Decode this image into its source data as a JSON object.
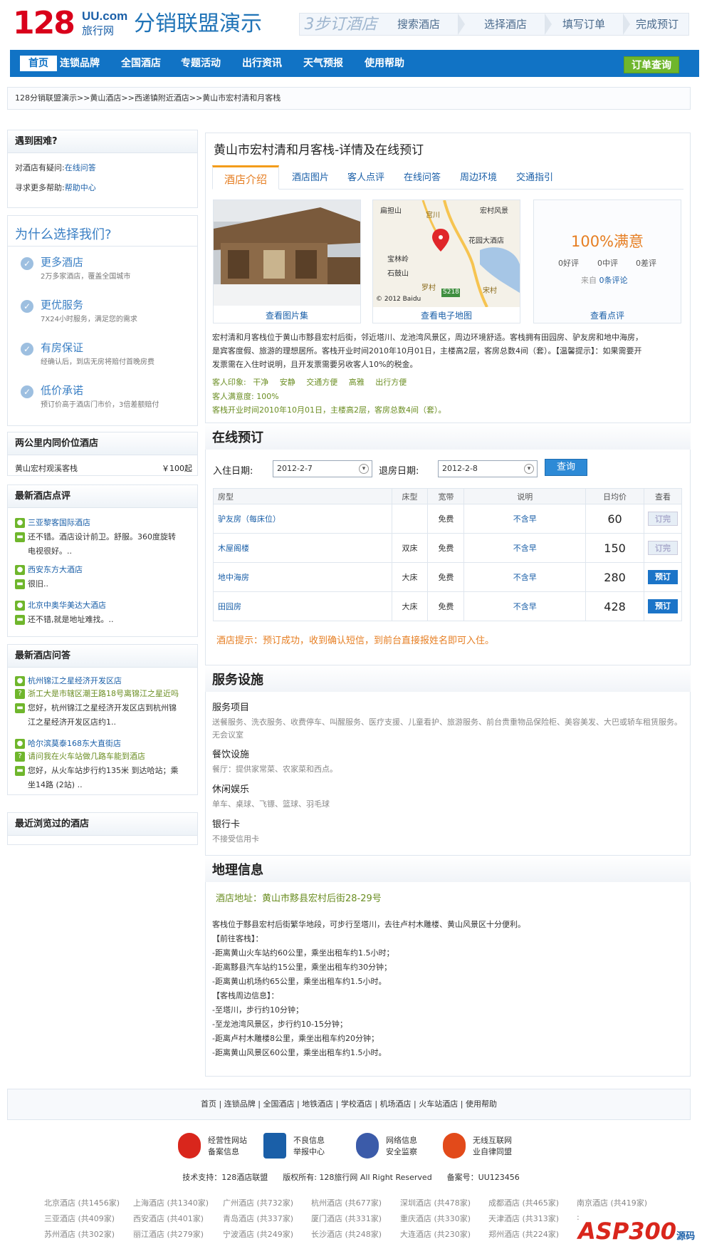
{
  "header": {
    "logo_num": "128",
    "logo_uu": "UU.com",
    "logo_text": "旅行网",
    "brand": "分销联盟演示",
    "steps_title": "3步订酒店",
    "steps": [
      "搜索酒店",
      "选择酒店",
      "填写订单",
      "完成预订"
    ]
  },
  "nav": {
    "items": [
      "首页",
      "连锁品牌",
      "全国酒店",
      "专题活动",
      "出行资讯",
      "天气预报",
      "使用帮助"
    ],
    "order_query": "订单查询"
  },
  "breadcrumb": "128分销联盟演示>>黄山酒店>>西递镇附近酒店>>黄山市宏村清和月客栈",
  "sidebar": {
    "help": {
      "title": "遇到困难?",
      "q1_label": "对酒店有疑问:",
      "q1_link": "在线问答",
      "q2_label": "寻求更多帮助:",
      "q2_link": "帮助中心"
    },
    "why": {
      "title": "为什么选择我们?",
      "items": [
        {
          "t": "更多酒店",
          "d": "2万多家酒店，覆盖全国城市"
        },
        {
          "t": "更优服务",
          "d": "7X24小时服务，满足您的需求"
        },
        {
          "t": "有房保证",
          "d": "经确认后，到店无房将赔付首晚房费"
        },
        {
          "t": "低价承诺",
          "d": "预订价高于酒店门市价，3倍差额赔付"
        }
      ]
    },
    "nearby": {
      "title": "两公里内同价位酒店",
      "hotel": "黄山宏村观溪客栈",
      "price": "￥100起"
    },
    "reviews": {
      "title": "最新酒店点评",
      "items": [
        {
          "hotel": "三亚黎客国际酒店",
          "text1": "还不错。酒店设计前卫。舒服。360度旋转",
          "text2": "电视很好。.."
        },
        {
          "hotel": "西安东方大酒店",
          "text1": "很旧.."
        },
        {
          "hotel": "北京中奥华美达大酒店",
          "text1": "还不错,就是地址难找。.."
        }
      ]
    },
    "qa": {
      "title": "最新酒店问答",
      "items": [
        {
          "hotel": "杭州锦江之星经济开发区店",
          "q": "浙工大是市辖区潮王路18号离锦江之星近吗",
          "a1": "您好，杭州锦江之星经济开发区店到杭州锦",
          "a2": "江之星经济开发区店约1.."
        },
        {
          "hotel": "哈尔滨莫泰168东大直街店",
          "q": "请问我在火车站做几路车能到酒店",
          "a1": "您好，从火车站步行约135米 到达哈站；乘",
          "a2": "坐14路 (2站) .."
        }
      ]
    },
    "recent": {
      "title": "最近浏览过的酒店"
    }
  },
  "main": {
    "title": "黄山市宏村清和月客栈-详情及在线预订",
    "tabs": [
      "酒店介绍",
      "酒店图片",
      "客人点评",
      "在线问答",
      "周边环境",
      "交通指引"
    ],
    "photo_caption": "查看图片集",
    "map": {
      "labels": [
        "扁担山",
        "宫川",
        "宏村风景",
        "花园大酒店",
        "宝林岭",
        "石鼓山",
        "罗村",
        "宋村",
        "S218"
      ],
      "copyright": "© 2012 Baidu",
      "caption": "查看电子地图"
    },
    "rating": {
      "score": "100%满意",
      "good": "0好评",
      "mid": "0中评",
      "bad": "0差评",
      "from_label": "来自",
      "from_link": "0条评论",
      "caption": "查看点评"
    },
    "desc": [
      "宏村清和月客栈位于黄山市黟县宏村后街，邻近塔川、龙池湾风景区，周边环境舒适。客栈拥有田园房、驴友房和地中海房，",
      "是宾客度假、旅游的理想居所。客栈开业时间2010年10月01日，主楼高2层，客房总数4间（套）。【温馨提示】：如果需要开",
      "发票需在入住时说明，且开发票需要另收客人10%的税金。"
    ],
    "impression_label": "客人印象:",
    "impressions": [
      "干净",
      "安静",
      "交通方便",
      "高雅",
      "出行方便"
    ],
    "satisfaction": "客人满意度:  100%",
    "opened": "客栈开业时间2010年10月01日，主楼高2层，客房总数4间（套）。"
  },
  "booking": {
    "title": "在线预订",
    "checkin_label": "入住日期:",
    "checkin": "2012-2-7",
    "checkout_label": "退房日期:",
    "checkout": "2012-2-8",
    "query": "查询",
    "headers": [
      "房型",
      "床型",
      "宽带",
      "说明",
      "日均价",
      "查看"
    ],
    "rooms": [
      {
        "name": "驴友房（每床位）",
        "bed": "",
        "net": "免费",
        "note": "不含早",
        "price": "60",
        "action": "订完"
      },
      {
        "name": "木屋阁楼",
        "bed": "双床",
        "net": "免费",
        "note": "不含早",
        "price": "150",
        "action": "订完"
      },
      {
        "name": "地中海房",
        "bed": "大床",
        "net": "免费",
        "note": "不含早",
        "price": "280",
        "action": "预订"
      },
      {
        "name": "田园房",
        "bed": "大床",
        "net": "免费",
        "note": "不含早",
        "price": "428",
        "action": "预订"
      }
    ],
    "tip": "酒店提示：预订成功，收到确认短信，到前台直接报姓名即可入住。"
  },
  "services": {
    "title": "服务设施",
    "items": [
      {
        "t": "服务项目",
        "d": "送餐服务、洗衣服务、收费停车、叫醒服务、医疗支援、儿童看护、旅游服务、前台贵重物品保险柜、美容美发、大巴或轿车租赁服务。无会议室"
      },
      {
        "t": "餐饮设施",
        "d": "餐厅：提供家常菜、农家菜和西点。"
      },
      {
        "t": "休闲娱乐",
        "d": "单车、桌球、飞镖、篮球、羽毛球"
      },
      {
        "t": "银行卡",
        "d": "不接受信用卡"
      }
    ]
  },
  "geo": {
    "title": "地理信息",
    "address": "酒店地址：黄山市黟县宏村后街28-29号",
    "lines": [
      "客栈位于黟县宏村后街繁华地段，可步行至塔川，去往卢村木雕楼、黄山风景区十分便利。",
      "【前往客栈】：",
      "-距离黄山火车站约60公里，乘坐出租车约1.5小时；",
      "-距离黟县汽车站约15公里，乘坐出租车约30分钟；",
      "-距离黄山机场约65公里，乘坐出租车约1.5小时。",
      "【客栈周边信息】：",
      "-至塔川，步行约10分钟；",
      "-至龙池湾风景区，步行约10-15分钟；",
      "-距离卢村木雕楼8公里，乘坐出租车约20分钟；",
      "-距离黄山风景区60公里，乘坐出租车约1.5小时。"
    ]
  },
  "footer": {
    "links": "首页 | 连锁品牌 | 全国酒店 | 地铁酒店 | 学校酒店 | 机场酒店 | 火车站酒店 | 使用帮助",
    "badges": [
      {
        "l1": "经营性网站",
        "l2": "备案信息",
        "color": "#d9261c"
      },
      {
        "l1": "不良信息",
        "l2": "举报中心",
        "color": "#1a5fa8"
      },
      {
        "l1": "网络信息",
        "l2": "安全监察",
        "color": "#3b5ba9"
      },
      {
        "l1": "无线互联网",
        "l2": "业自律同盟",
        "color": "#e24a1a"
      }
    ],
    "copyright": "技术支持：128酒店联盟      版权所有: 128旅行网 All Right Reserved      备案号：UU123456",
    "cities": [
      [
        "北京酒店 (共1456家)",
        "上海酒店 (共1340家)",
        "广州酒店 (共732家)",
        "杭州酒店 (共677家)",
        "深圳酒店 (共478家)",
        "成都酒店 (共465家)",
        "南京酒店 (共419家)"
      ],
      [
        "三亚酒店 (共409家)",
        "西安酒店 (共401家)",
        "青岛酒店 (共337家)",
        "厦门酒店 (共331家)",
        "重庆酒店 (共330家)",
        "天津酒店 (共313家)",
        ":"
      ],
      [
        "苏州酒店 (共302家)",
        "丽江酒店 (共279家)",
        "宁波酒店 (共249家)",
        "长沙酒店 (共248家)",
        "大连酒店 (共230家)",
        "郑州酒店 (共224家)",
        ""
      ]
    ],
    "watermark": "ASP300",
    "watermark2": "源码"
  },
  "colors": {
    "accent": "#1173c5",
    "orange": "#e67e22",
    "green": "#6b8e23",
    "red": "#d9001b"
  }
}
